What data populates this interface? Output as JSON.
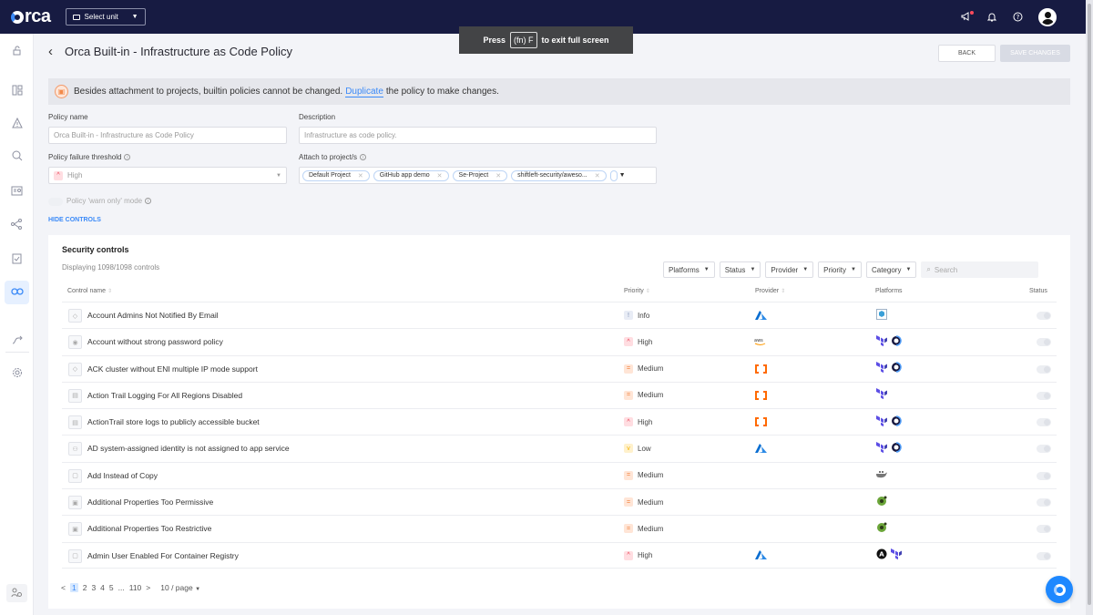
{
  "topbar": {
    "logo": "orca",
    "unit_select_label": "Select unit",
    "icons": [
      "announcements-icon",
      "bell-icon",
      "help-icon",
      "user-avatar"
    ]
  },
  "toast": {
    "prefix": "Press",
    "key": "(fn) F",
    "suffix": "to exit full screen"
  },
  "sidebar": {
    "items": [
      {
        "icon": "lock-icon",
        "active": false
      },
      {
        "icon": "dashboard-icon",
        "active": false
      },
      {
        "icon": "alert-icon",
        "active": false
      },
      {
        "icon": "search-icon",
        "active": false
      },
      {
        "icon": "inventory-icon",
        "active": false
      },
      {
        "icon": "graph-icon",
        "active": false
      },
      {
        "icon": "compliance-icon",
        "active": false
      },
      {
        "icon": "shift-left-icon",
        "active": true
      },
      {
        "icon": "automation-icon",
        "active": false
      },
      {
        "icon": "settings-icon",
        "active": false
      }
    ],
    "bottom_icon": "users-icon"
  },
  "header": {
    "title": "Orca Built-in - Infrastructure as Code Policy",
    "back_button": "BACK",
    "save_button": "SAVE CHANGES"
  },
  "notice": {
    "text_before": "Besides attachment to projects, builtin policies cannot be changed.",
    "link": "Duplicate",
    "text_after": "the policy to make changes."
  },
  "form": {
    "policy_name_label": "Policy name",
    "policy_name_value": "Orca Built-in - Infrastructure as Code Policy",
    "description_label": "Description",
    "description_value": "Infrastructure as code policy.",
    "threshold_label": "Policy failure threshold",
    "threshold_value": "High",
    "attach_label": "Attach to project/s",
    "projects": [
      "Default Project",
      "GitHub app demo",
      "Se-Project",
      "shiftleft-security/aweso..."
    ],
    "warn_only_label": "Policy 'warn only' mode",
    "warn_only_enabled": false,
    "hide_controls": "HIDE CONTROLS"
  },
  "controls": {
    "title": "Security controls",
    "subtitle": "Displaying 1098/1098 controls",
    "filters": [
      "Platforms",
      "Status",
      "Provider",
      "Priority",
      "Category"
    ],
    "search_placeholder": "Search",
    "columns": {
      "name": "Control name",
      "priority": "Priority",
      "provider": "Provider",
      "platforms": "Platforms",
      "status": "Status"
    },
    "rows": [
      {
        "icon": "info-circle",
        "name": "Account Admins Not Notified By Email",
        "priority": "Info",
        "provider": "azure",
        "platforms": [
          "cloudformation-box"
        ],
        "enabled": false
      },
      {
        "icon": "password",
        "name": "Account without strong password policy",
        "priority": "High",
        "provider": "aws",
        "platforms": [
          "terraform",
          "pulumi"
        ],
        "enabled": false
      },
      {
        "icon": "info-circle",
        "name": "ACK cluster without ENI multiple IP mode support",
        "priority": "Medium",
        "provider": "alibaba",
        "platforms": [
          "terraform",
          "pulumi"
        ],
        "enabled": false
      },
      {
        "icon": "logging",
        "name": "Action Trail Logging For All Regions Disabled",
        "priority": "Medium",
        "provider": "alibaba",
        "platforms": [
          "terraform"
        ],
        "enabled": false
      },
      {
        "icon": "logging",
        "name": "ActionTrail store logs to publicly accessible bucket",
        "priority": "High",
        "provider": "alibaba",
        "platforms": [
          "terraform",
          "pulumi"
        ],
        "enabled": false
      },
      {
        "icon": "identity",
        "name": "AD system-assigned identity is not assigned to app service",
        "priority": "Low",
        "provider": "azure",
        "platforms": [
          "terraform",
          "pulumi"
        ],
        "enabled": false
      },
      {
        "icon": "doc-search",
        "name": "Add Instead of Copy",
        "priority": "Medium",
        "provider": "",
        "platforms": [
          "docker"
        ],
        "enabled": false
      },
      {
        "icon": "doc",
        "name": "Additional Properties Too Permissive",
        "priority": "Medium",
        "provider": "",
        "platforms": [
          "openapi"
        ],
        "enabled": false
      },
      {
        "icon": "doc",
        "name": "Additional Properties Too Restrictive",
        "priority": "Medium",
        "provider": "",
        "platforms": [
          "openapi"
        ],
        "enabled": false
      },
      {
        "icon": "doc-search",
        "name": "Admin User Enabled For Container Registry",
        "priority": "High",
        "provider": "azure",
        "platforms": [
          "ansible",
          "terraform"
        ],
        "enabled": false
      }
    ]
  },
  "pagination": {
    "pages": [
      "1",
      "2",
      "3",
      "4",
      "5",
      "...",
      "110"
    ],
    "current": "1",
    "page_size": "10 / page"
  },
  "colors": {
    "topbar": "#171b42",
    "accent": "#3b8af8",
    "high": "#e8394d",
    "medium": "#f07a33",
    "low": "#f5b400"
  }
}
